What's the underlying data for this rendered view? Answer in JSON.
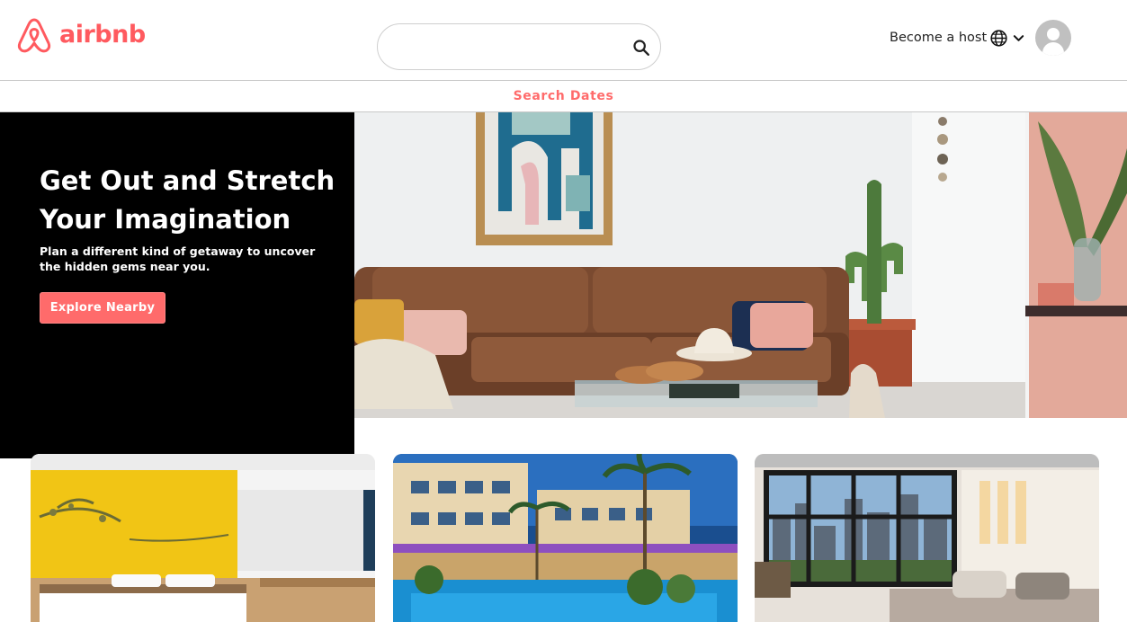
{
  "brand": {
    "name": "airbnb",
    "color": "#ff5a5f",
    "logo_icon": "airbnb-belo-icon"
  },
  "search": {
    "value": "",
    "placeholder": "",
    "icon": "search-icon"
  },
  "header": {
    "host_label": "Become a host",
    "globe_icon": "globe-icon",
    "menu_icon": "chevron-down-icon",
    "avatar_icon": "user-avatar-icon"
  },
  "dates_bar": {
    "label": "Search Dates",
    "color": "#ff6b6b"
  },
  "hero": {
    "title": "Get Out and Stretch Your Imagination",
    "subtitle": "Plan a different kind of getaway to uncover the hidden gems near you.",
    "button_label": "Explore Nearby",
    "panel_color": "#000000",
    "image": "living-room-sofa-cactus-photo"
  },
  "cards": [
    {
      "image": "hotel-room-yellow-wall-photo"
    },
    {
      "image": "resort-pool-palm-trees-photo"
    },
    {
      "image": "loft-bedroom-city-view-photo"
    }
  ]
}
